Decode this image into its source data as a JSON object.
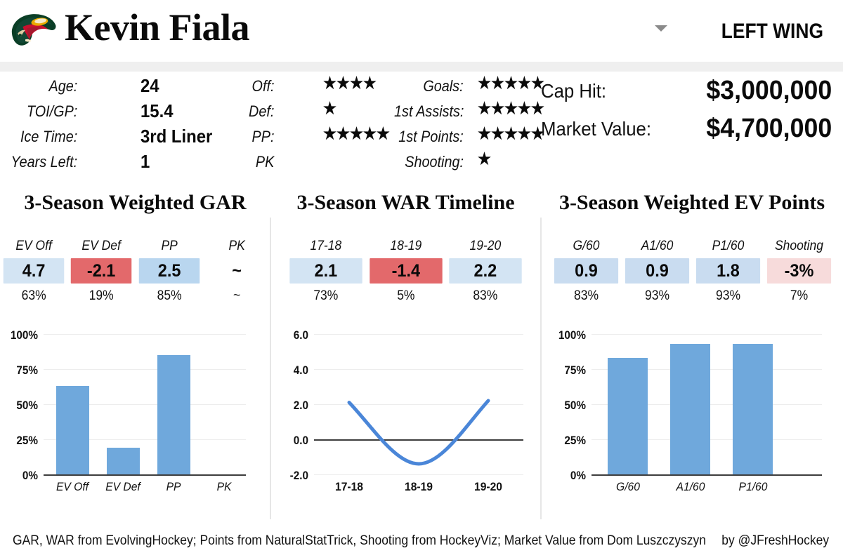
{
  "header": {
    "team_logo": "minnesota-wild-logo",
    "player_name": "Kevin Fiala",
    "position": "LEFT WING",
    "position_caret": "chevron-down-icon"
  },
  "bio": [
    {
      "label": "Age:",
      "value": "24"
    },
    {
      "label": "TOI/GP:",
      "value": "15.4"
    },
    {
      "label": "Ice Time:",
      "value": "3rd Liner"
    },
    {
      "label": "Years Left:",
      "value": "1"
    }
  ],
  "ratings": [
    {
      "label": "Off:",
      "stars": "★★★★",
      "count": 4
    },
    {
      "label": "Def:",
      "stars": "★",
      "count": 1
    },
    {
      "label": "PP:",
      "stars": "★★★★★",
      "count": 5
    },
    {
      "label": "PK",
      "stars": "",
      "count": 0
    }
  ],
  "scoring": [
    {
      "label": "Goals:",
      "stars": "★★★★★",
      "count": 5
    },
    {
      "label": "1st Assists:",
      "stars": "★★★★★",
      "count": 5
    },
    {
      "label": "1st Points:",
      "stars": "★★★★★",
      "count": 5
    },
    {
      "label": "Shooting:",
      "stars": "★",
      "count": 1
    }
  ],
  "money": [
    {
      "label": "Cap Hit:",
      "value": "$3,000,000"
    },
    {
      "label": "Market Value:",
      "value": "$4,700,000"
    }
  ],
  "panels": {
    "gar": {
      "title": "3-Season Weighted GAR"
    },
    "war": {
      "title": "3-Season WAR Timeline"
    },
    "points": {
      "title": "3-Season Weighted EV Points"
    }
  },
  "gar_table": {
    "headers": [
      "EV Off",
      "EV Def",
      "PP",
      "PK"
    ],
    "values": [
      "4.7",
      "-2.1",
      "2.5",
      "~"
    ],
    "percentiles": [
      "63%",
      "19%",
      "85%",
      "~"
    ],
    "cell_colors": [
      "#d3e4f3",
      "#e3696b",
      "#b9d6ef",
      "transparent"
    ]
  },
  "war_table": {
    "headers": [
      "17-18",
      "18-19",
      "19-20"
    ],
    "values": [
      "2.1",
      "-1.4",
      "2.2"
    ],
    "percentiles": [
      "73%",
      "5%",
      "83%"
    ],
    "cell_colors": [
      "#d3e4f3",
      "#e3696b",
      "#d3e4f3"
    ]
  },
  "points_table": {
    "headers": [
      "G/60",
      "A1/60",
      "P1/60",
      "Shooting"
    ],
    "values": [
      "0.9",
      "0.9",
      "1.8",
      "-3%"
    ],
    "percentiles": [
      "83%",
      "93%",
      "93%",
      "7%"
    ],
    "cell_colors": [
      "#c9dcf0",
      "#c9dcf0",
      "#c9dcf0",
      "#f7dbdb"
    ]
  },
  "colors": {
    "bar_blue": "#6fa8dc",
    "line_blue": "#4a86d8",
    "cell_blue": "#d3e4f3",
    "cell_red": "#e3696b",
    "cell_pink": "#f7dbdb",
    "axis": "#3d3d3d",
    "grid": "#ededed",
    "divider": "#e6e6e6",
    "header_band": "#efefef"
  },
  "chart_data": [
    {
      "type": "bar",
      "title": "3-Season Weighted GAR",
      "categories": [
        "EV Off",
        "EV Def",
        "PP",
        "PK"
      ],
      "values": [
        63,
        19,
        85,
        null
      ],
      "raw_values": [
        4.7,
        -2.1,
        2.5,
        null
      ],
      "ylabel": "",
      "xlabel": "",
      "ylim": [
        0,
        100
      ],
      "yticks": [
        "0%",
        "25%",
        "50%",
        "75%",
        "100%"
      ],
      "ytick_values": [
        0,
        25,
        50,
        75,
        100
      ],
      "grid": true,
      "legend": "none"
    },
    {
      "type": "line",
      "title": "3-Season WAR Timeline",
      "x": [
        "17-18",
        "18-19",
        "19-20"
      ],
      "values": [
        2.1,
        -1.4,
        2.2
      ],
      "percentiles": [
        73,
        5,
        83
      ],
      "ylabel": "",
      "xlabel": "",
      "ylim": [
        -2.0,
        6.0
      ],
      "yticks": [
        "-2.0",
        "0.0",
        "2.0",
        "4.0",
        "6.0"
      ],
      "ytick_values": [
        -2,
        0,
        2,
        4,
        6
      ],
      "grid": true,
      "zeroline": true,
      "legend": "none"
    },
    {
      "type": "bar",
      "title": "3-Season Weighted EV Points",
      "categories": [
        "G/60",
        "A1/60",
        "P1/60"
      ],
      "values": [
        83,
        93,
        93
      ],
      "raw_values": [
        0.9,
        0.9,
        1.8
      ],
      "ylabel": "",
      "xlabel": "",
      "ylim": [
        0,
        100
      ],
      "yticks": [
        "0%",
        "25%",
        "50%",
        "75%",
        "100%"
      ],
      "ytick_values": [
        0,
        25,
        50,
        75,
        100
      ],
      "grid": true,
      "legend": "none"
    }
  ],
  "footer": {
    "credit": "GAR, WAR from EvolvingHockey; Points from NaturalStatTrick, Shooting from HockeyViz; Market Value from Dom Luszczyszyn",
    "byline": "by @JFreshHockey"
  }
}
